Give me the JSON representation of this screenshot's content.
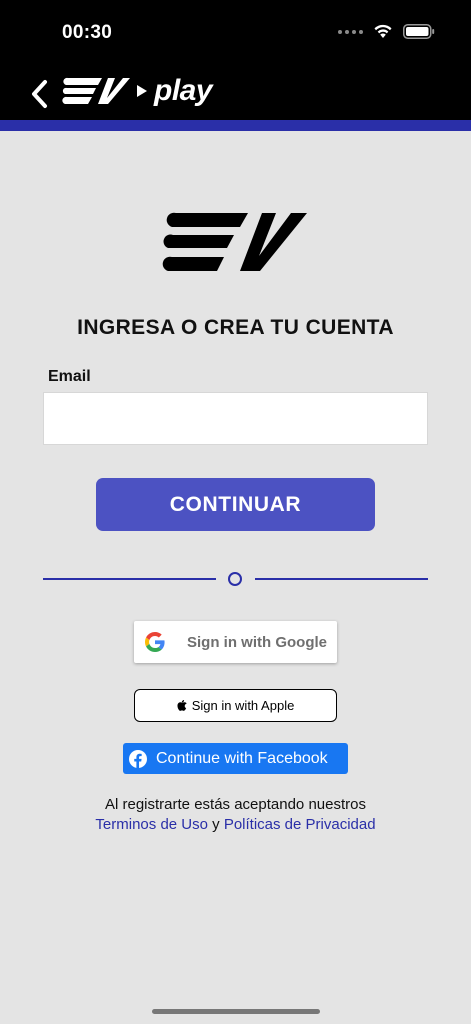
{
  "status_bar": {
    "time": "00:30"
  },
  "header": {
    "brand_play": "play"
  },
  "login": {
    "headline": "INGRESA O CREA TU CUENTA",
    "email_label": "Email",
    "email_value": "",
    "email_placeholder": "",
    "continue_label": "CONTINUAR"
  },
  "social": {
    "google_label": "Sign in with Google",
    "apple_label": "Sign in with Apple",
    "facebook_label": "Continue with Facebook"
  },
  "terms": {
    "text": "Al registrarte estás aceptando nuestros",
    "terms_link": "Terminos de Uso",
    "connector": "y",
    "privacy_link": "Políticas de Privacidad"
  },
  "colors": {
    "accent": "#2a2fa8",
    "button": "#4c52c2",
    "facebook": "#1877f2",
    "background": "#e4e4e4"
  },
  "icons": [
    "back-chevron-icon",
    "ev-logo-icon",
    "play-triangle-icon",
    "wifi-icon",
    "battery-icon",
    "google-g-icon",
    "apple-icon",
    "facebook-icon"
  ]
}
